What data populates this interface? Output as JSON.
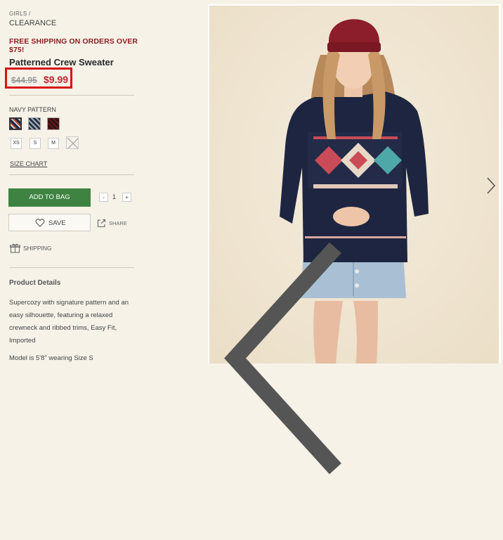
{
  "breadcrumb": {
    "parent": "GIRLS /",
    "current": "CLEARANCE"
  },
  "promo": "FREE SHIPPING ON ORDERS OVER $75!",
  "product": {
    "title": "Patterned Crew Sweater",
    "original_price": "$44.95",
    "sale_price": "$9.99",
    "color_label": "NAVY PATTERN",
    "colors": [
      "navy-pattern",
      "grey-pattern",
      "burgundy-pattern"
    ],
    "sizes": [
      "XS",
      "S",
      "M",
      "L"
    ],
    "size_l_available": false,
    "size_chart": "SIZE CHART"
  },
  "actions": {
    "add_to_bag": "ADD TO BAG",
    "qty_minus": "-",
    "qty": "1",
    "qty_plus": "+",
    "save": "SAVE",
    "share": "SHARE",
    "shipping": "SHIPPING"
  },
  "details": {
    "title": "Product Details",
    "text": "Supercozy with signature pattern and an easy silhouette, featuring a relaxed crewneck and ribbed trims, Easy Fit, Imported",
    "model": "Model is 5'8\" wearing Size S"
  },
  "colors": {
    "promo": "#8b1e1e",
    "sale": "#c1272d",
    "add_button": "#3e8341",
    "highlight_box": "#d61313"
  },
  "icons": [
    "heart-icon",
    "share-icon",
    "gift-box-icon",
    "chevron-left-icon",
    "chevron-right-icon"
  ]
}
